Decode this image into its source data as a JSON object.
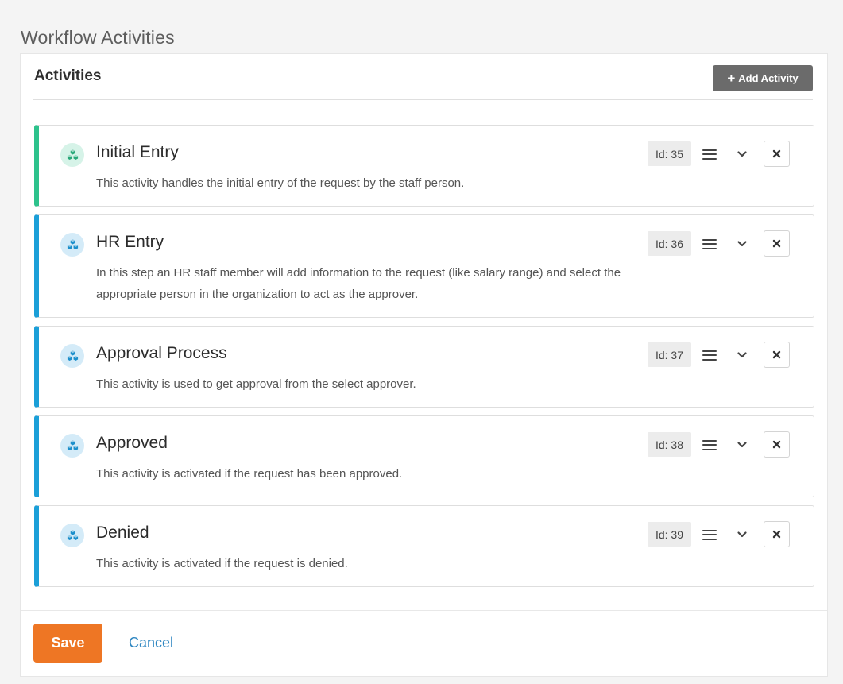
{
  "section_title": "Workflow Activities",
  "panel": {
    "heading": "Activities",
    "add_button_label": "Add Activity"
  },
  "activities": [
    {
      "title": "Initial Entry",
      "description": "This activity handles the initial entry of the request by the staff person.",
      "id_label": "Id: 35",
      "accent_color": "#2dc28c",
      "icon_bg": "#d6f3e8",
      "icon_color": "#27a878"
    },
    {
      "title": "HR Entry",
      "description": "In this step an HR staff member will add information to the request (like salary range) and select the appropriate person in the organization to act as the approver.",
      "id_label": "Id: 36",
      "accent_color": "#1b9fd8",
      "icon_bg": "#d4ebf8",
      "icon_color": "#1b8fcb"
    },
    {
      "title": "Approval Process",
      "description": "This activity is used to get approval from the select approver.",
      "id_label": "Id: 37",
      "accent_color": "#1b9fd8",
      "icon_bg": "#d4ebf8",
      "icon_color": "#1b8fcb"
    },
    {
      "title": "Approved",
      "description": "This activity is activated if the request has been approved.",
      "id_label": "Id: 38",
      "accent_color": "#1b9fd8",
      "icon_bg": "#d4ebf8",
      "icon_color": "#1b8fcb"
    },
    {
      "title": "Denied",
      "description": "This activity is activated if the request is denied.",
      "id_label": "Id: 39",
      "accent_color": "#1b9fd8",
      "icon_bg": "#d4ebf8",
      "icon_color": "#1b8fcb"
    }
  ],
  "icons": {
    "activity": "cubes-icon",
    "drag": "reorder-handle-icon",
    "expand": "chevron-down-icon",
    "remove": "close-icon",
    "add": "plus-icon"
  },
  "footer": {
    "save_label": "Save",
    "cancel_label": "Cancel"
  },
  "colors": {
    "save_button": "#ee7624",
    "cancel_link": "#2e86c1",
    "add_button": "#6b6b6b"
  }
}
